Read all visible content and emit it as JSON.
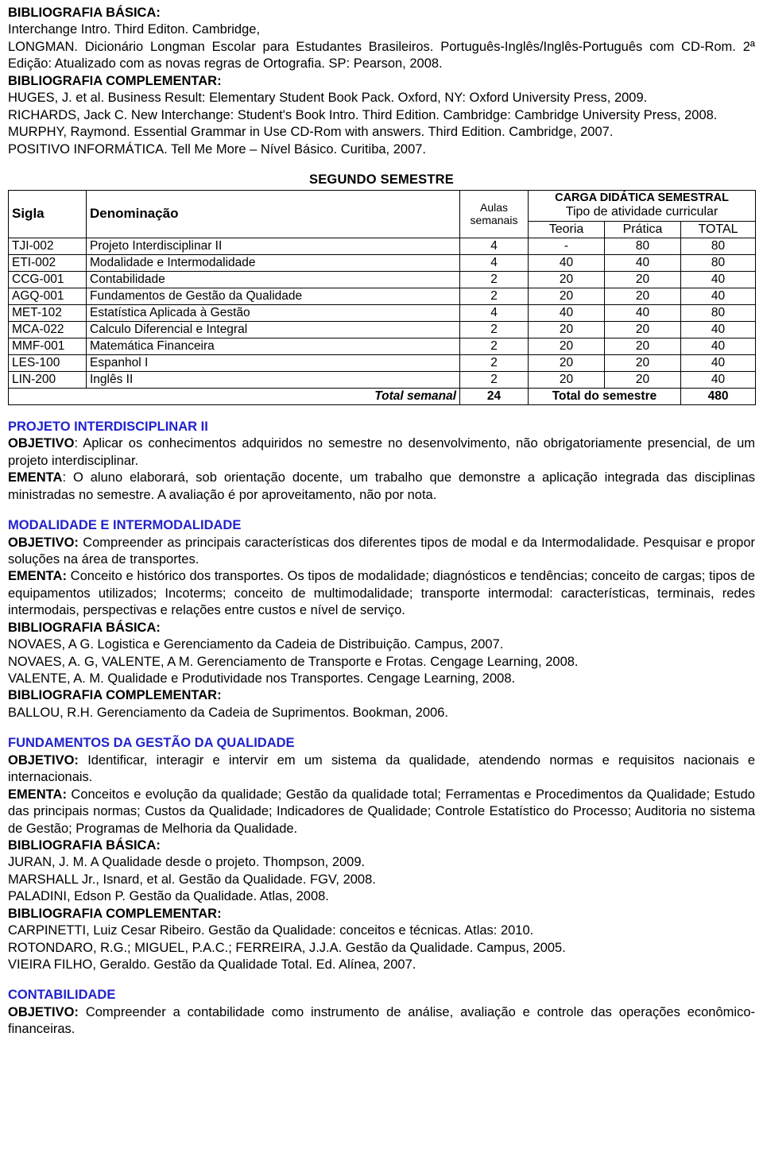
{
  "top_bibliography": {
    "basica_label": "BIBLIOGRAFIA BÁSICA:",
    "basica_items": [
      "Interchange Intro. Third Editon. Cambridge,",
      "LONGMAN. Dicionário Longman Escolar para Estudantes Brasileiros. Português-Inglês/Inglês-Português com CD-Rom. 2ª Edição: Atualizado com as novas regras de Ortografia. SP: Pearson, 2008."
    ],
    "complementar_label": "BIBLIOGRAFIA COMPLEMENTAR:",
    "complementar_items": [
      "HUGES, J. et al. Business Result: Elementary Student Book Pack. Oxford, NY: Oxford University Press, 2009.",
      "RICHARDS, Jack C. New Interchange: Student's Book Intro. Third Edition. Cambridge: Cambridge University Press, 2008.",
      "MURPHY, Raymond. Essential Grammar in Use CD-Rom with answers. Third Edition. Cambridge, 2007.",
      "POSITIVO INFORMÁTICA. Tell Me More – Nível Básico. Curitiba, 2007."
    ]
  },
  "semester": {
    "title": "SEGUNDO SEMESTRE",
    "headers": {
      "sigla": "Sigla",
      "denominacao": "Denominação",
      "aulas_line1": "Aulas",
      "aulas_line2": "semanais",
      "carga_line1": "CARGA DIDÁTICA SEMESTRAL",
      "carga_line2": "Tipo de atividade curricular",
      "teoria": "Teoria",
      "pratica": "Prática",
      "total": "TOTAL"
    },
    "rows": [
      {
        "sigla": "TJI-002",
        "denominacao": "Projeto Interdisciplinar II",
        "aulas": "4",
        "teoria": "-",
        "pratica": "80",
        "total": "80"
      },
      {
        "sigla": "ETI-002",
        "denominacao": "Modalidade e Intermodalidade",
        "aulas": "4",
        "teoria": "40",
        "pratica": "40",
        "total": "80"
      },
      {
        "sigla": "CCG-001",
        "denominacao": "Contabilidade",
        "aulas": "2",
        "teoria": "20",
        "pratica": "20",
        "total": "40"
      },
      {
        "sigla": "AGQ-001",
        "denominacao": "Fundamentos de Gestão da Qualidade",
        "aulas": "2",
        "teoria": "20",
        "pratica": "20",
        "total": "40"
      },
      {
        "sigla": "MET-102",
        "denominacao": "Estatística Aplicada à Gestão",
        "aulas": "4",
        "teoria": "40",
        "pratica": "40",
        "total": "80"
      },
      {
        "sigla": "MCA-022",
        "denominacao": "Calculo Diferencial e Integral",
        "aulas": "2",
        "teoria": "20",
        "pratica": "20",
        "total": "40"
      },
      {
        "sigla": "MMF-001",
        "denominacao": "Matemática Financeira",
        "aulas": "2",
        "teoria": "20",
        "pratica": "20",
        "total": "40"
      },
      {
        "sigla": "LES-100",
        "denominacao": "Espanhol I",
        "aulas": "2",
        "teoria": "20",
        "pratica": "20",
        "total": "40"
      },
      {
        "sigla": "LIN-200",
        "denominacao": "Inglês II",
        "aulas": "2",
        "teoria": "20",
        "pratica": "20",
        "total": "40"
      }
    ],
    "footer": {
      "total_semanal_label": "Total semanal",
      "total_semanal_value": "24",
      "total_semestre_label": "Total do semestre",
      "total_semestre_value": "480"
    }
  },
  "disciplines": [
    {
      "title": "PROJETO INTERDISCIPLINAR II",
      "objetivo_label": "OBJETIVO",
      "objetivo_sep": ": ",
      "objetivo_text": "Aplicar os conhecimentos adquiridos no semestre no desenvolvimento, não obrigatoriamente presencial, de um projeto interdisciplinar.",
      "ementa_label": "EMENTA",
      "ementa_sep": ": ",
      "ementa_text": "O aluno elaborará, sob orientação docente, um trabalho que demonstre a aplicação integrada das disciplinas ministradas no semestre. A avaliação é por aproveitamento, não por nota."
    },
    {
      "title": "MODALIDADE E INTERMODALIDADE",
      "objetivo_label": "OBJETIVO:",
      "objetivo_sep": " ",
      "objetivo_text": "Compreender as principais características dos diferentes tipos de modal e da Intermodalidade. Pesquisar e propor soluções na área de  transportes.",
      "ementa_label": "EMENTA:",
      "ementa_sep": " ",
      "ementa_text": "Conceito e histórico dos transportes. Os tipos de modalidade; diagnósticos e tendências; conceito de cargas; tipos de equipamentos utilizados; Incoterms; conceito de multimodalidade; transporte intermodal: características, terminais, redes intermodais, perspectivas e relações entre custos e nível de serviço.",
      "basica_label": "BIBLIOGRAFIA BÁSICA:",
      "basica_items": [
        "NOVAES, A G. Logistica e Gerenciamento da Cadeia de Distribuição. Campus, 2007.",
        "NOVAES, A. G, VALENTE, A M. Gerenciamento de Transporte e Frotas. Cengage Learning, 2008.",
        "VALENTE, A. M. Qualidade e Produtividade nos Transportes. Cengage Learning, 2008."
      ],
      "complementar_label": "BIBLIOGRAFIA COMPLEMENTAR:",
      "complementar_items": [
        "BALLOU, R.H. Gerenciamento da Cadeia de Suprimentos. Bookman, 2006."
      ]
    },
    {
      "title": "FUNDAMENTOS DA GESTÃO DA QUALIDADE",
      "objetivo_label": "OBJETIVO:",
      "objetivo_sep": " ",
      "objetivo_text": "Identificar, interagir e intervir em um sistema da qualidade, atendendo normas e requisitos nacionais e internacionais.",
      "ementa_label": "EMENTA:",
      "ementa_sep": " ",
      "ementa_text": "Conceitos e evolução da qualidade; Gestão da qualidade total; Ferramentas e Procedimentos da Qualidade; Estudo das principais normas; Custos da Qualidade; Indicadores de Qualidade; Controle Estatístico do Processo; Auditoria no sistema de Gestão; Programas de Melhoria da Qualidade.",
      "basica_label": "BIBLIOGRAFIA BÁSICA:",
      "basica_items": [
        "JURAN, J. M. A Qualidade desde o projeto. Thompson, 2009.",
        "MARSHALL Jr., Isnard, et al. Gestão da Qualidade. FGV, 2008.",
        "PALADINI, Edson P. Gestão da Qualidade. Atlas, 2008."
      ],
      "complementar_label": "BIBLIOGRAFIA COMPLEMENTAR:",
      "complementar_items": [
        "CARPINETTI, Luiz Cesar Ribeiro. Gestão da Qualidade: conceitos e técnicas. Atlas: 2010.",
        "ROTONDARO, R.G.; MIGUEL, P.A.C.; FERREIRA, J.J.A. Gestão da Qualidade. Campus, 2005.",
        "VIEIRA FILHO, Geraldo. Gestão da Qualidade Total. Ed. Alínea, 2007."
      ]
    },
    {
      "title": "CONTABILIDADE",
      "objetivo_label": "OBJETIVO:",
      "objetivo_sep": " ",
      "objetivo_text": "Compreender a contabilidade como instrumento de análise, avaliação e controle das operações econômico-financeiras."
    }
  ],
  "colors": {
    "heading_blue": "#2222cc",
    "text_black": "#000000"
  }
}
